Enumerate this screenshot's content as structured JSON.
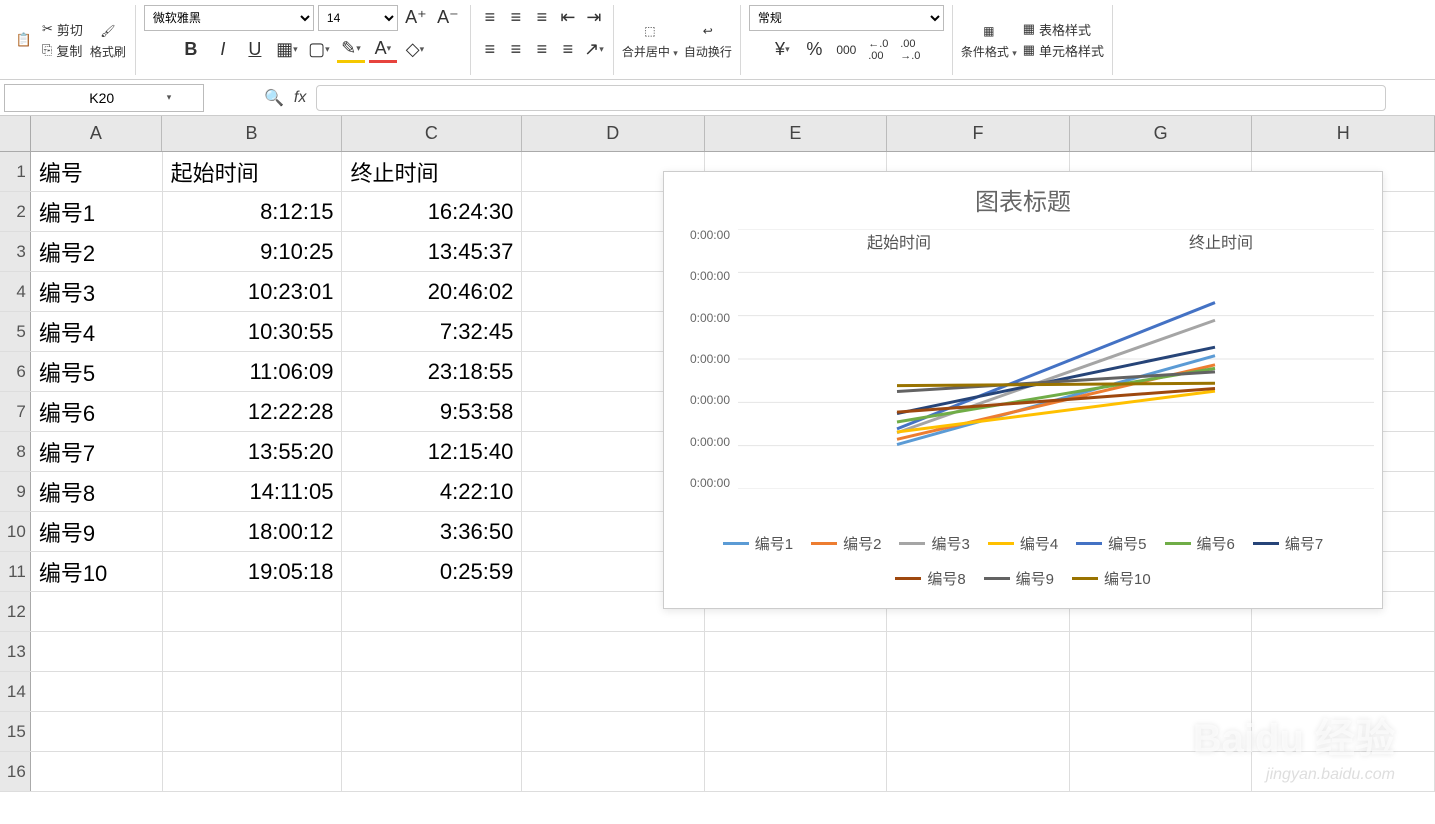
{
  "ribbon": {
    "cut": "剪切",
    "copy": "复制",
    "format_painter": "格式刷",
    "font_family": "微软雅黑",
    "font_size": "14",
    "merge_center": "合并居中",
    "wrap_text": "自动换行",
    "number_format": "常规",
    "cond_format": "条件格式",
    "table_style": "表格样式",
    "cell_style": "单元格样式"
  },
  "formula_bar": {
    "name_box": "K20",
    "formula": ""
  },
  "columns": [
    "A",
    "B",
    "C",
    "D",
    "E",
    "F",
    "G",
    "H"
  ],
  "headers": {
    "A": "编号",
    "B": "起始时间",
    "C": "终止时间"
  },
  "rows": [
    {
      "n": "1",
      "A": "编号",
      "B": "起始时间",
      "C": "终止时间"
    },
    {
      "n": "2",
      "A": "编号1",
      "B": "8:12:15",
      "C": "16:24:30"
    },
    {
      "n": "3",
      "A": "编号2",
      "B": "9:10:25",
      "C": "13:45:37"
    },
    {
      "n": "4",
      "A": "编号3",
      "B": "10:23:01",
      "C": "20:46:02"
    },
    {
      "n": "5",
      "A": "编号4",
      "B": "10:30:55",
      "C": "7:32:45"
    },
    {
      "n": "6",
      "A": "编号5",
      "B": "11:06:09",
      "C": "23:18:55"
    },
    {
      "n": "7",
      "A": "编号6",
      "B": "12:22:28",
      "C": "9:53:58"
    },
    {
      "n": "8",
      "A": "编号7",
      "B": "13:55:20",
      "C": "12:15:40"
    },
    {
      "n": "9",
      "A": "编号8",
      "B": "14:11:05",
      "C": "4:22:10"
    },
    {
      "n": "10",
      "A": "编号9",
      "B": "18:00:12",
      "C": "3:36:50"
    },
    {
      "n": "11",
      "A": "编号10",
      "B": "19:05:18",
      "C": "0:25:59"
    },
    {
      "n": "12",
      "A": "",
      "B": "",
      "C": ""
    },
    {
      "n": "13",
      "A": "",
      "B": "",
      "C": ""
    },
    {
      "n": "14",
      "A": "",
      "B": "",
      "C": ""
    },
    {
      "n": "15",
      "A": "",
      "B": "",
      "C": ""
    },
    {
      "n": "16",
      "A": "",
      "B": "",
      "C": ""
    }
  ],
  "chart": {
    "title": "图表标题",
    "x_labels": [
      "起始时间",
      "终止时间"
    ],
    "y_label_text": "0:00:00",
    "legend": [
      {
        "name": "编号1",
        "color": "#5b9bd5"
      },
      {
        "name": "编号2",
        "color": "#ed7d31"
      },
      {
        "name": "编号3",
        "color": "#a5a5a5"
      },
      {
        "name": "编号4",
        "color": "#ffc000"
      },
      {
        "name": "编号5",
        "color": "#4472c4"
      },
      {
        "name": "编号6",
        "color": "#70ad47"
      },
      {
        "name": "编号7",
        "color": "#264478"
      },
      {
        "name": "编号8",
        "color": "#9e480e"
      },
      {
        "name": "编号9",
        "color": "#636363"
      },
      {
        "name": "编号10",
        "color": "#997300"
      }
    ]
  },
  "chart_data": {
    "type": "line",
    "title": "图表标题",
    "categories": [
      "起始时间",
      "终止时间"
    ],
    "xlabel": "",
    "ylabel": "",
    "y_ticks_text": [
      "0:00:00",
      "0:00:00",
      "0:00:00",
      "0:00:00",
      "0:00:00",
      "0:00:00",
      "0:00:00"
    ],
    "series": [
      {
        "name": "编号1",
        "color": "#5b9bd5",
        "values": [
          "8:12:15",
          "16:24:30"
        ]
      },
      {
        "name": "编号2",
        "color": "#ed7d31",
        "values": [
          "9:10:25",
          "13:45:37"
        ]
      },
      {
        "name": "编号3",
        "color": "#a5a5a5",
        "values": [
          "10:23:01",
          "20:46:02"
        ]
      },
      {
        "name": "编号4",
        "color": "#ffc000",
        "values": [
          "10:30:55",
          "7:32:45"
        ]
      },
      {
        "name": "编号5",
        "color": "#4472c4",
        "values": [
          "11:06:09",
          "23:18:55"
        ]
      },
      {
        "name": "编号6",
        "color": "#70ad47",
        "values": [
          "12:22:28",
          "9:53:58"
        ]
      },
      {
        "name": "编号7",
        "color": "#264478",
        "values": [
          "13:55:20",
          "12:15:40"
        ]
      },
      {
        "name": "编号8",
        "color": "#9e480e",
        "values": [
          "14:11:05",
          "4:22:10"
        ]
      },
      {
        "name": "编号9",
        "color": "#636363",
        "values": [
          "18:00:12",
          "3:36:50"
        ]
      },
      {
        "name": "编号10",
        "color": "#997300",
        "values": [
          "19:05:18",
          "0:25:59"
        ]
      }
    ]
  },
  "watermark": {
    "main": "Baidu 经验",
    "sub": "jingyan.baidu.com"
  }
}
